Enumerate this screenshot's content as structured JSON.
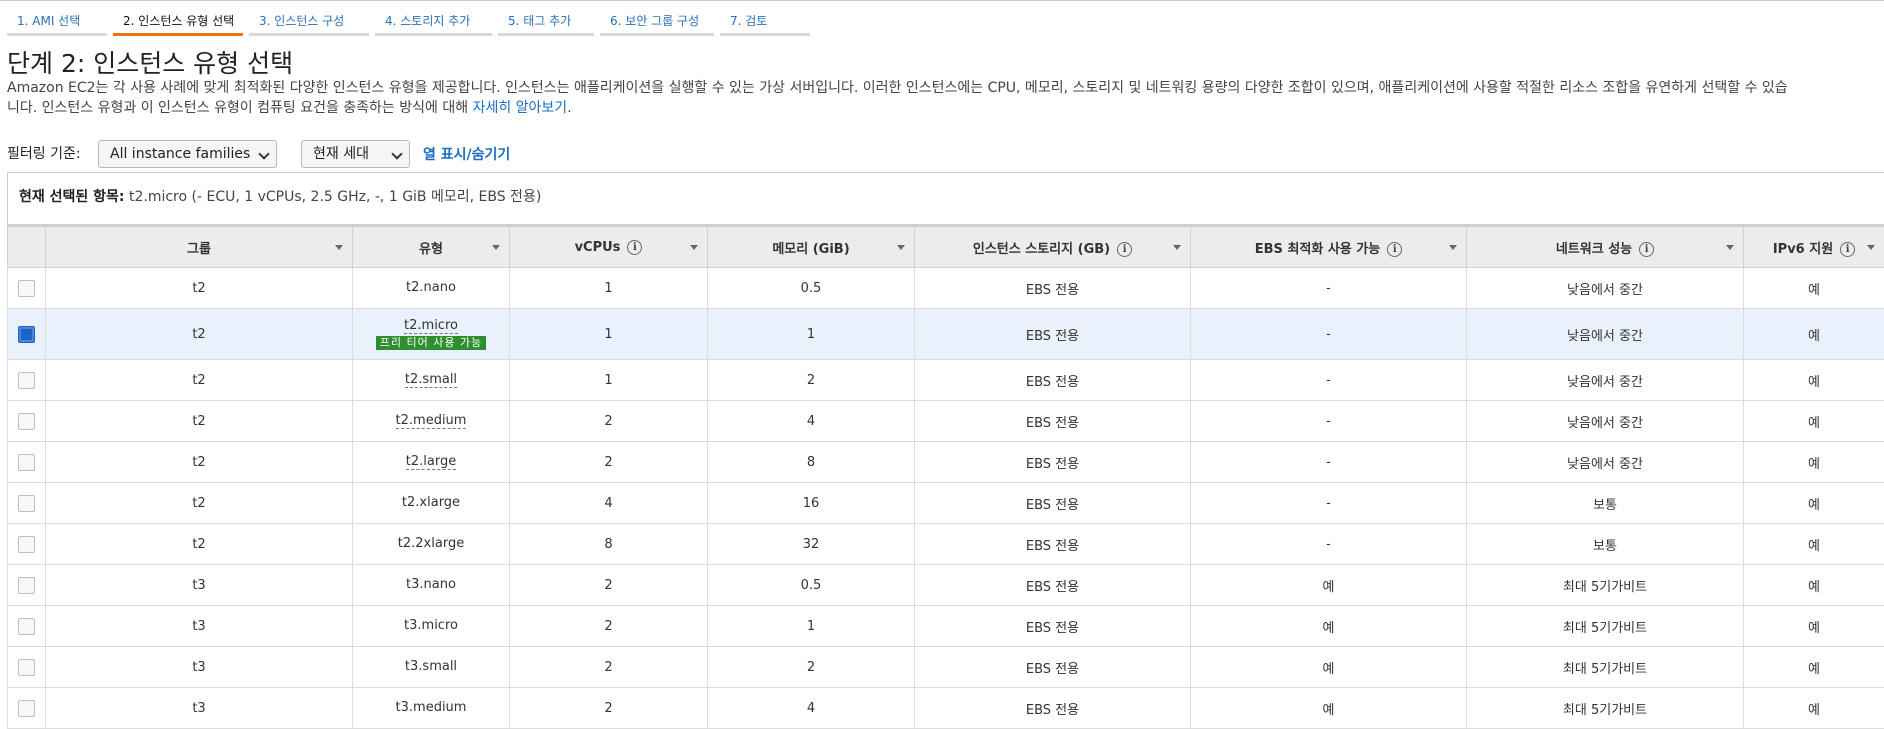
{
  "steps": [
    {
      "label": "1. AMI 선택",
      "active": false
    },
    {
      "label": "2. 인스턴스 유형 선택",
      "active": true
    },
    {
      "label": "3. 인스턴스 구성",
      "active": false
    },
    {
      "label": "4. 스토리지 추가",
      "active": false
    },
    {
      "label": "5. 태그 추가",
      "active": false
    },
    {
      "label": "6. 보안 그룹 구성",
      "active": false
    },
    {
      "label": "7. 검토",
      "active": false
    }
  ],
  "page": {
    "title": "단계 2: 인스턴스 유형 선택",
    "desc_line1": "Amazon EC2는 각 사용 사례에 맞게 최적화된 다양한 인스턴스 유형을 제공합니다. 인스턴스는 애플리케이션을 실행할 수 있는 가상 서버입니다. 이러한 인스턴스에는 CPU, 메모리, 스토리지 및 네트워킹 용량의 다양한 조합이 있으며, 애플리케이션에 사용할 적절한 리소스 조합을 유연하게 선택할 수 있습",
    "desc_line2": "니다. 인스턴스 유형과 이 인스턴스 유형이 컴퓨팅 요건을 충족하는 방식에 대해 ",
    "learn_more": "자세히 알아보기",
    "desc_end": "."
  },
  "filter": {
    "label": "필터링 기준:",
    "family_select": "All instance families",
    "generation_select": "현재 세대",
    "column_toggle": "열 표시/숨기기"
  },
  "selection": {
    "label": "현재 선택된 항목:",
    "value": "t2.micro (- ECU, 1 vCPUs, 2.5 GHz, -, 1 GiB 메모리, EBS 전용)"
  },
  "table": {
    "headers": {
      "group": "그룹",
      "type": "유형",
      "vcpus": "vCPUs",
      "memory": "메모리 (GiB)",
      "storage": "인스턴스 스토리지 (GB)",
      "ebs": "EBS 최적화 사용 가능",
      "network": "네트워크 성능",
      "ipv6": "IPv6 지원"
    },
    "free_tier_badge": "프리 티어 사용 가능",
    "rows": [
      {
        "group": "t2",
        "type": "t2.nano",
        "vcpus": "1",
        "memory": "0.5",
        "storage": "EBS 전용",
        "ebs": "-",
        "network": "낮음에서 중간",
        "ipv6": "예",
        "selected": false
      },
      {
        "group": "t2",
        "type": "t2.micro",
        "vcpus": "1",
        "memory": "1",
        "storage": "EBS 전용",
        "ebs": "-",
        "network": "낮음에서 중간",
        "ipv6": "예",
        "selected": true
      },
      {
        "group": "t2",
        "type": "t2.small",
        "vcpus": "1",
        "memory": "2",
        "storage": "EBS 전용",
        "ebs": "-",
        "network": "낮음에서 중간",
        "ipv6": "예",
        "selected": false
      },
      {
        "group": "t2",
        "type": "t2.medium",
        "vcpus": "2",
        "memory": "4",
        "storage": "EBS 전용",
        "ebs": "-",
        "network": "낮음에서 중간",
        "ipv6": "예",
        "selected": false
      },
      {
        "group": "t2",
        "type": "t2.large",
        "vcpus": "2",
        "memory": "8",
        "storage": "EBS 전용",
        "ebs": "-",
        "network": "낮음에서 중간",
        "ipv6": "예",
        "selected": false
      },
      {
        "group": "t2",
        "type": "t2.xlarge",
        "vcpus": "4",
        "memory": "16",
        "storage": "EBS 전용",
        "ebs": "-",
        "network": "보통",
        "ipv6": "예",
        "selected": false
      },
      {
        "group": "t2",
        "type": "t2.2xlarge",
        "vcpus": "8",
        "memory": "32",
        "storage": "EBS 전용",
        "ebs": "-",
        "network": "보통",
        "ipv6": "예",
        "selected": false
      },
      {
        "group": "t3",
        "type": "t3.nano",
        "vcpus": "2",
        "memory": "0.5",
        "storage": "EBS 전용",
        "ebs": "예",
        "network": "최대 5기가비트",
        "ipv6": "예",
        "selected": false
      },
      {
        "group": "t3",
        "type": "t3.micro",
        "vcpus": "2",
        "memory": "1",
        "storage": "EBS 전용",
        "ebs": "예",
        "network": "최대 5기가비트",
        "ipv6": "예",
        "selected": false
      },
      {
        "group": "t3",
        "type": "t3.small",
        "vcpus": "2",
        "memory": "2",
        "storage": "EBS 전용",
        "ebs": "예",
        "network": "최대 5기가비트",
        "ipv6": "예",
        "selected": false
      },
      {
        "group": "t3",
        "type": "t3.medium",
        "vcpus": "2",
        "memory": "4",
        "storage": "EBS 전용",
        "ebs": "예",
        "network": "최대 5기가비트",
        "ipv6": "예",
        "selected": false
      }
    ]
  }
}
